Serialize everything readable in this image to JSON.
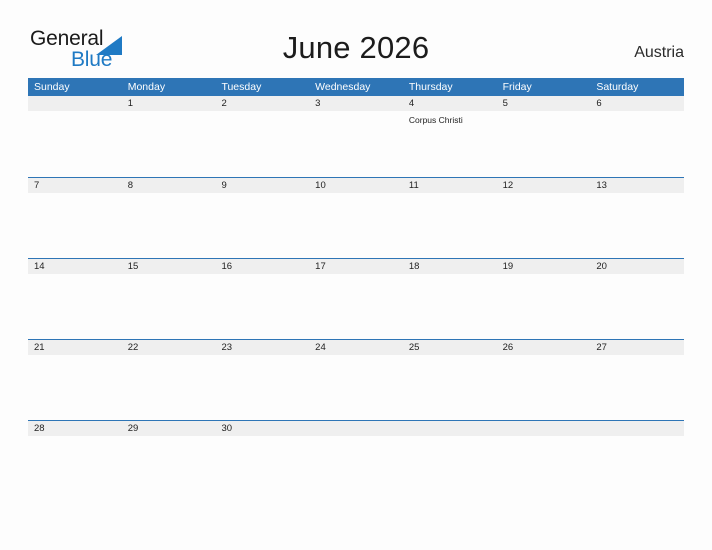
{
  "brand": {
    "word_one": "General",
    "word_two": "Blue",
    "flag_icon": "flag-triangle-icon",
    "flag_color": "#1f7ac4",
    "word_one_color": "#1a1a1a",
    "word_two_color": "#1f7ac4"
  },
  "header": {
    "title": "June 2026",
    "country": "Austria"
  },
  "colors": {
    "header_blue": "#2e75b6",
    "date_band_gray": "#efefef",
    "page_background": "#fdfdfd",
    "text": "#222222"
  },
  "calendar": {
    "weekdays": [
      "Sunday",
      "Monday",
      "Tuesday",
      "Wednesday",
      "Thursday",
      "Friday",
      "Saturday"
    ],
    "weeks": [
      {
        "days": [
          {
            "num": "",
            "events": []
          },
          {
            "num": "1",
            "events": []
          },
          {
            "num": "2",
            "events": []
          },
          {
            "num": "3",
            "events": []
          },
          {
            "num": "4",
            "events": [
              "Corpus Christi"
            ]
          },
          {
            "num": "5",
            "events": []
          },
          {
            "num": "6",
            "events": []
          }
        ]
      },
      {
        "days": [
          {
            "num": "7",
            "events": []
          },
          {
            "num": "8",
            "events": []
          },
          {
            "num": "9",
            "events": []
          },
          {
            "num": "10",
            "events": []
          },
          {
            "num": "11",
            "events": []
          },
          {
            "num": "12",
            "events": []
          },
          {
            "num": "13",
            "events": []
          }
        ]
      },
      {
        "days": [
          {
            "num": "14",
            "events": []
          },
          {
            "num": "15",
            "events": []
          },
          {
            "num": "16",
            "events": []
          },
          {
            "num": "17",
            "events": []
          },
          {
            "num": "18",
            "events": []
          },
          {
            "num": "19",
            "events": []
          },
          {
            "num": "20",
            "events": []
          }
        ]
      },
      {
        "days": [
          {
            "num": "21",
            "events": []
          },
          {
            "num": "22",
            "events": []
          },
          {
            "num": "23",
            "events": []
          },
          {
            "num": "24",
            "events": []
          },
          {
            "num": "25",
            "events": []
          },
          {
            "num": "26",
            "events": []
          },
          {
            "num": "27",
            "events": []
          }
        ]
      },
      {
        "days": [
          {
            "num": "28",
            "events": []
          },
          {
            "num": "29",
            "events": []
          },
          {
            "num": "30",
            "events": []
          },
          {
            "num": "",
            "events": []
          },
          {
            "num": "",
            "events": []
          },
          {
            "num": "",
            "events": []
          },
          {
            "num": "",
            "events": []
          }
        ]
      }
    ]
  }
}
